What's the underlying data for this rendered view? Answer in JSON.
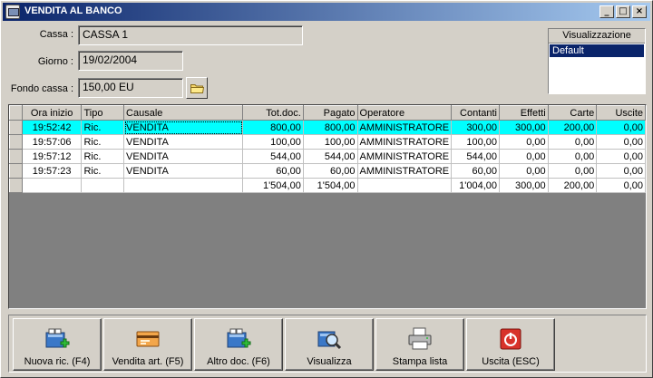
{
  "window": {
    "title": "VENDITA AL BANCO",
    "controls": {
      "minimize": "_",
      "maximize": "□",
      "close": "×"
    }
  },
  "form": {
    "cassa_label": "Cassa :",
    "cassa_value": "CASSA 1",
    "giorno_label": "Giorno :",
    "giorno_value": "19/02/2004",
    "fondo_label": "Fondo cassa :",
    "fondo_value": "150,00 EU"
  },
  "visualizzazione": {
    "header": "Visualizzazione",
    "items": [
      "Default"
    ]
  },
  "table": {
    "columns": [
      "Ora inizio",
      "Tipo",
      "Causale",
      "Tot.doc.",
      "Pagato",
      "Operatore",
      "Contanti",
      "Effetti",
      "Carte",
      "Uscite"
    ],
    "rows": [
      [
        "19:52:42",
        "Ric.",
        "VENDITA",
        "800,00",
        "800,00",
        "AMMINISTRATORE",
        "300,00",
        "300,00",
        "200,00",
        "0,00"
      ],
      [
        "19:57:06",
        "Ric.",
        "VENDITA",
        "100,00",
        "100,00",
        "AMMINISTRATORE",
        "100,00",
        "0,00",
        "0,00",
        "0,00"
      ],
      [
        "19:57:12",
        "Ric.",
        "VENDITA",
        "544,00",
        "544,00",
        "AMMINISTRATORE",
        "544,00",
        "0,00",
        "0,00",
        "0,00"
      ],
      [
        "19:57:23",
        "Ric.",
        "VENDITA",
        "60,00",
        "60,00",
        "AMMINISTRATORE",
        "60,00",
        "0,00",
        "0,00",
        "0,00"
      ]
    ],
    "totals": [
      "",
      "",
      "",
      "1'504,00",
      "1'504,00",
      "",
      "1'004,00",
      "300,00",
      "200,00",
      "0,00"
    ],
    "selected_row": 0
  },
  "toolbar": {
    "buttons": [
      {
        "label": "Nuova ric. (F4)",
        "icon": "new-receipt-icon"
      },
      {
        "label": "Vendita art. (F5)",
        "icon": "sell-article-icon"
      },
      {
        "label": "Altro doc. (F6)",
        "icon": "other-document-icon"
      },
      {
        "label": "Visualizza",
        "icon": "view-magnifier-icon"
      },
      {
        "label": "Stampa lista",
        "icon": "printer-icon"
      },
      {
        "label": "Uscita (ESC)",
        "icon": "exit-icon"
      }
    ]
  },
  "colors": {
    "selection": "#00ffff",
    "title_start": "#0a246a",
    "title_end": "#a6caf0",
    "face": "#d4d0c8",
    "grid_empty": "#808080"
  }
}
